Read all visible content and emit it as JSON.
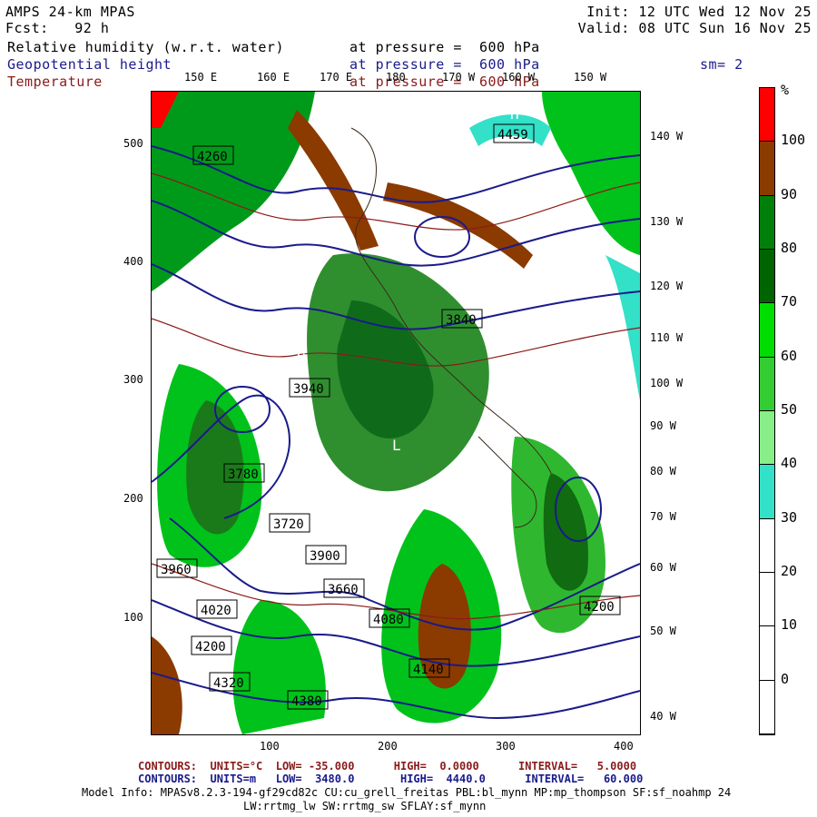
{
  "header": {
    "model": "AMPS 24-km MPAS",
    "fcst_label": "Fcst:",
    "fcst_value": "92 h",
    "init": "Init: 12 UTC Wed 12 Nov 25",
    "valid": "Valid: 08 UTC Sun 16 Nov 25"
  },
  "fields": [
    {
      "name": "Relative humidity (w.r.t. water)",
      "at": "at pressure =",
      "value": "600 hPa",
      "color": "#000000"
    },
    {
      "name": "Geopotential height",
      "at": "at pressure =",
      "value": "600 hPa",
      "color": "#1a1a8c"
    },
    {
      "name": "Temperature",
      "at": "at pressure =",
      "value": "600 hPa",
      "color": "#8b1a1a"
    }
  ],
  "smoothing": "sm= 2",
  "top_lon_labels": [
    "150 E",
    "160 E",
    "170 E",
    "180",
    "170 W",
    "160 W",
    "150 W"
  ],
  "right_lon_labels": [
    "140 W",
    "130 W",
    "120 W",
    "110 W",
    "100 W",
    "90 W",
    "80 W",
    "70 W",
    "60 W",
    "50 W",
    "40 W"
  ],
  "y_ticks": [
    "500",
    "400",
    "300",
    "200",
    "100"
  ],
  "x_ticks": [
    "100",
    "200",
    "300",
    "400"
  ],
  "colorbar": {
    "unit": "%",
    "labels": [
      "100",
      "90",
      "80",
      "70",
      "60",
      "50",
      "40",
      "30",
      "20",
      "10",
      "0"
    ],
    "colors": [
      "#ff0000",
      "#8b3a00",
      "#00800a",
      "#006400",
      "#00dd00",
      "#33cc33",
      "#88ee88",
      "#33e0c8",
      "#ffffff",
      "#ffffff",
      "#ffffff",
      "#ffffff"
    ]
  },
  "height_labels": [
    "4260",
    "4380",
    "4200",
    "4320",
    "4140",
    "4080",
    "4020",
    "3960",
    "3900",
    "3840",
    "3780",
    "3720",
    "3660",
    "4459",
    "3940",
    "4200"
  ],
  "footer": {
    "line1": "CONTOURS:  UNITS=°C  LOW= -35.000      HIGH=  0.0000      INTERVAL=   5.0000",
    "line2": "CONTOURS:  UNITS=m   LOW=  3480.0       HIGH=  4440.0      INTERVAL=   60.000",
    "info1": "Model Info: MPASv8.2.3-194-gf29cd82c CU:cu_grell_freitas PBL:bl_mynn MP:mp_thompson SF:sf_noahmp 24",
    "info2": "LW:rrtmg_lw SW:rrtmg_sw SFLAY:sf_mynn"
  }
}
